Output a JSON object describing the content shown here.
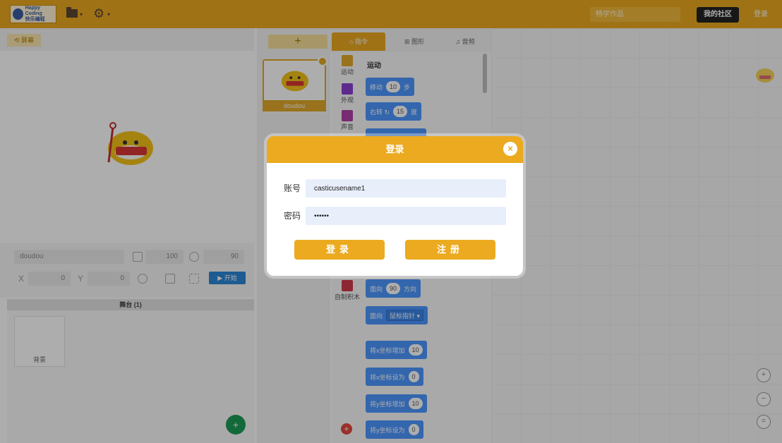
{
  "header": {
    "logo_text": "Happy Coding",
    "logo_sub": "快乐编程",
    "search_placeholder": "畅学作品",
    "community_label": "我的社区",
    "login_label": "登录"
  },
  "stage": {
    "screen_button": "⟲ 屏幕",
    "sprite_name_value": "doudou",
    "size_value": "100",
    "direction_value": "90",
    "x_label": "X",
    "x_value": "0",
    "y_label": "Y",
    "y_value": "0",
    "start_label": "▶ 开始",
    "list_header": "舞台  (1)",
    "background_label": "背景"
  },
  "sprites": {
    "add_label": "+",
    "items": [
      {
        "name": "doudou"
      }
    ]
  },
  "tabs": [
    {
      "label": "⌂ 指令"
    },
    {
      "label": "⊞ 图形"
    },
    {
      "label": "♫ 音频"
    }
  ],
  "categories": [
    {
      "label": "运动",
      "color": "#e0a82a"
    },
    {
      "label": "外观",
      "color": "#8a3fd1"
    },
    {
      "label": "声音",
      "color": "#b13ea8"
    },
    {
      "label": "自制积木",
      "color": "#d03a4a"
    }
  ],
  "blocks": {
    "category_title": "运动",
    "move": {
      "text": "移动",
      "value": "10",
      "suffix": "步"
    },
    "turn_right": {
      "text": "右转 ↻",
      "value": "15",
      "suffix": "度"
    },
    "point_dir": {
      "text": "面向",
      "value": "90",
      "suffix": "方向"
    },
    "point_toward": {
      "text": "面向",
      "dropdown": "鼠标指针 ▾"
    },
    "change_x": {
      "text": "将x坐标增加",
      "value": "10"
    },
    "set_x": {
      "text": "将x坐标设为",
      "value": "0"
    },
    "change_y": {
      "text": "将y坐标增加",
      "value": "10"
    },
    "set_y": {
      "text": "将y坐标设为",
      "value": "0"
    }
  },
  "login_dialog": {
    "title": "登录",
    "close_icon": "×",
    "account_label": "账号",
    "account_value": "casticusename1",
    "password_label": "密码",
    "password_value": "••••••",
    "login_button": "登录",
    "register_button": "注册"
  },
  "colors": {
    "accent": "#ebaa1f",
    "block_blue": "#4c97ff",
    "start_blue": "#2c87d6"
  }
}
